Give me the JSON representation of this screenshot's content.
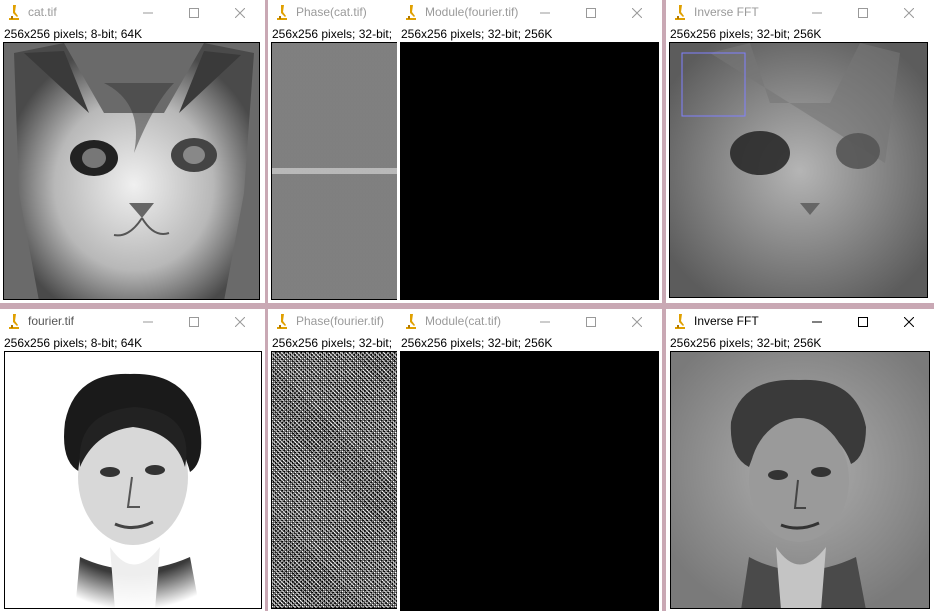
{
  "windows": [
    {
      "title": "cat.tif",
      "info": "256x256 pixels; 8-bit; 64K"
    },
    {
      "title": "Phase(cat.tif)",
      "info": "256x256 pixels; 32-bit;"
    },
    {
      "title": "Module(fourier.tif)",
      "info": "256x256 pixels; 32-bit; 256K"
    },
    {
      "title": "Inverse FFT",
      "info": "256x256 pixels; 32-bit; 256K"
    },
    {
      "title": "fourier.tif",
      "info": "256x256 pixels; 8-bit; 64K"
    },
    {
      "title": "Phase(fourier.tif)",
      "info": "256x256 pixels; 32-bit;"
    },
    {
      "title": "Module(cat.tif)",
      "info": "256x256 pixels; 32-bit; 256K"
    },
    {
      "title": "Inverse FFT",
      "info": "256x256 pixels; 32-bit; 256K"
    }
  ],
  "icons": {
    "app": "imagej-microscope-icon",
    "minimize": "minimize-icon",
    "maximize": "maximize-icon",
    "close": "close-icon"
  },
  "colors": {
    "desktop": "#c9a8b4",
    "selection_roi": "#8080ff",
    "icon_accent": "#e0a000"
  }
}
